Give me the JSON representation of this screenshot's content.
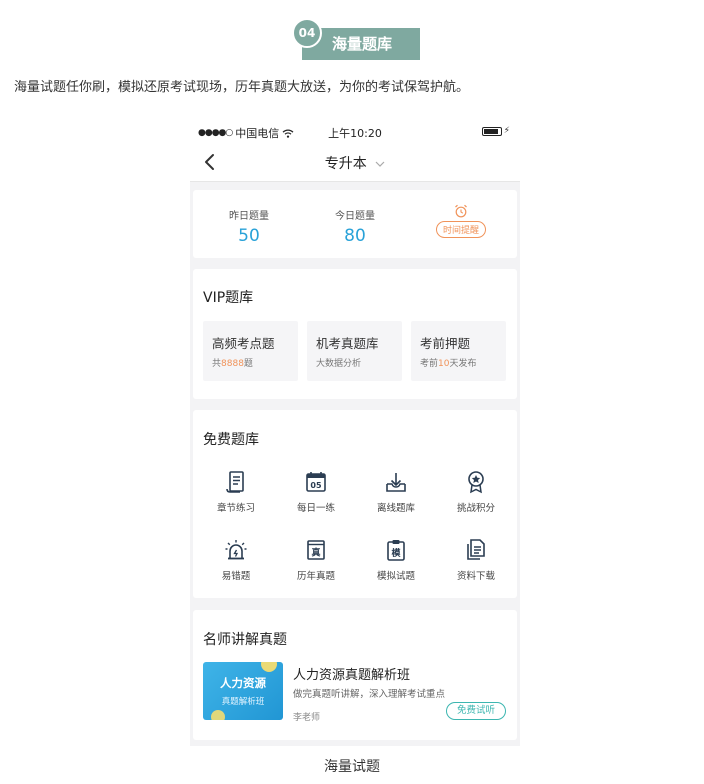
{
  "section": {
    "number": "04",
    "title": "海量题库"
  },
  "intro": "海量试题任你刷，模拟还原考试现场，历年真题大放送，为你的考试保驾护航。",
  "status_bar": {
    "dots": "●●●●○",
    "carrier": "中国电信",
    "time": "上午10:20"
  },
  "nav": {
    "title": "专升本"
  },
  "stats": {
    "yesterday_label": "昨日题量",
    "yesterday_value": "50",
    "today_label": "今日题量",
    "today_value": "80",
    "reminder_label": "时间提醒"
  },
  "vip": {
    "title": "VIP题库",
    "tiles": [
      {
        "title": "高频考点题",
        "sub_prefix": "共",
        "sub_highlight": "8888",
        "sub_suffix": "题"
      },
      {
        "title": "机考真题库",
        "sub_prefix": "大数据分析",
        "sub_highlight": "",
        "sub_suffix": ""
      },
      {
        "title": "考前押题",
        "sub_prefix": "考前",
        "sub_highlight": "10",
        "sub_suffix": "天发布"
      }
    ]
  },
  "free": {
    "title": "免费题库",
    "items": [
      {
        "label": "章节练习",
        "icon": "scroll-icon"
      },
      {
        "label": "每日一练",
        "icon": "calendar-icon"
      },
      {
        "label": "离线题库",
        "icon": "download-icon"
      },
      {
        "label": "挑战积分",
        "icon": "medal-icon"
      },
      {
        "label": "易错题",
        "icon": "alarm-light-icon"
      },
      {
        "label": "历年真题",
        "icon": "exam-paper-icon"
      },
      {
        "label": "模拟试题",
        "icon": "clipboard-icon"
      },
      {
        "label": "资料下载",
        "icon": "documents-icon"
      }
    ],
    "calendar_day": "05",
    "paper_char": "真",
    "clip_char": "模"
  },
  "teacher": {
    "title": "名师讲解真题",
    "thumb_title": "人力资源",
    "thumb_sub": "真题解析班",
    "course_title": "人力资源真题解析班",
    "course_desc": "做完真题听讲解，深入理解考试重点",
    "course_teacher": "李老师",
    "trial_label": "免费试听"
  },
  "caption": "海量试题",
  "colors": {
    "accent_blue": "#29a2d8",
    "accent_orange": "#f0935a",
    "badge_green": "#7fa9a0",
    "teal": "#3cb6b0"
  }
}
